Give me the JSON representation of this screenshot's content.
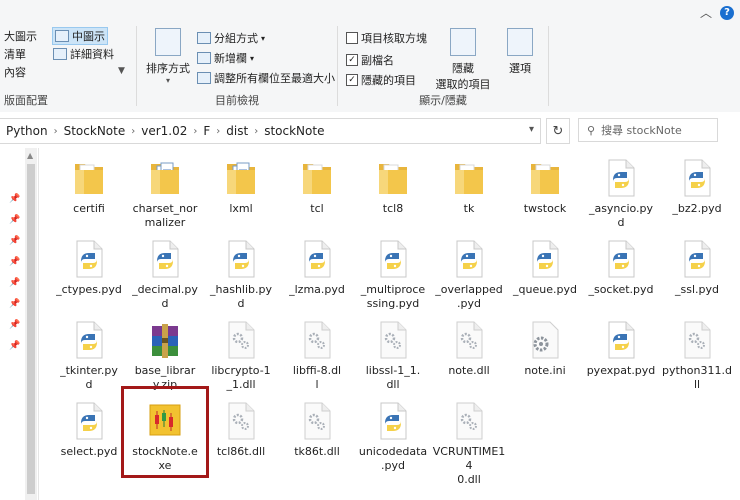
{
  "ribbon": {
    "layout": {
      "large_icons": "大圖示",
      "medium_icons": "中圖示",
      "list": "清單",
      "details": "詳細資料",
      "content": "內容",
      "group_label": "版面配置"
    },
    "current_view": {
      "sort_by": "排序方式",
      "group_by": "分組方式",
      "add_columns": "新增欄",
      "size_columns": "調整所有欄位至最適大小",
      "group_label": "目前檢視"
    },
    "show_hide": {
      "item_checkboxes": "項目核取方塊",
      "extensions": "副檔名",
      "hidden_items": "隱藏的項目",
      "hide_selected_1": "隱藏",
      "hide_selected_2": "選取的項目",
      "options": "選項",
      "group_label": "顯示/隱藏"
    }
  },
  "breadcrumb": [
    "Python",
    "StockNote",
    "ver1.02",
    "F",
    "dist",
    "stockNote"
  ],
  "search": {
    "placeholder": "搜尋 stockNote"
  },
  "files": [
    {
      "name": "certifi",
      "type": "folder"
    },
    {
      "name": "charset_normalizer",
      "type": "folder-doc"
    },
    {
      "name": "lxml",
      "type": "folder-doc"
    },
    {
      "name": "tcl",
      "type": "folder"
    },
    {
      "name": "tcl8",
      "type": "folder"
    },
    {
      "name": "tk",
      "type": "folder"
    },
    {
      "name": "twstock",
      "type": "folder"
    },
    {
      "name": "_asyncio.pyd",
      "type": "pyd"
    },
    {
      "name": "_bz2.pyd",
      "type": "pyd"
    },
    {
      "name": "_ctypes.pyd",
      "type": "pyd"
    },
    {
      "name": "_decimal.pyd",
      "type": "pyd"
    },
    {
      "name": "_hashlib.pyd",
      "type": "pyd"
    },
    {
      "name": "_lzma.pyd",
      "type": "pyd"
    },
    {
      "name": "_multiprocessing.pyd",
      "type": "pyd"
    },
    {
      "name": "_overlapped.pyd",
      "type": "pyd"
    },
    {
      "name": "_queue.pyd",
      "type": "pyd"
    },
    {
      "name": "_socket.pyd",
      "type": "pyd"
    },
    {
      "name": "_ssl.pyd",
      "type": "pyd"
    },
    {
      "name": "_tkinter.pyd",
      "type": "pyd"
    },
    {
      "name": "base_library.zip",
      "type": "zip"
    },
    {
      "name": "libcrypto-1_1.dll",
      "type": "dll"
    },
    {
      "name": "libffi-8.dll",
      "type": "dll"
    },
    {
      "name": "libssl-1_1.dll",
      "type": "dll"
    },
    {
      "name": "note.dll",
      "type": "dll"
    },
    {
      "name": "note.ini",
      "type": "ini"
    },
    {
      "name": "pyexpat.pyd",
      "type": "pyd"
    },
    {
      "name": "python311.dll",
      "type": "dll"
    },
    {
      "name": "select.pyd",
      "type": "pyd"
    },
    {
      "name": "stockNote.exe",
      "type": "exe"
    },
    {
      "name": "tcl86t.dll",
      "type": "dll"
    },
    {
      "name": "tk86t.dll",
      "type": "dll"
    },
    {
      "name": "unicodedata.pyd",
      "type": "pyd"
    },
    {
      "name": "VCRUNTIME140.dll",
      "type": "dll"
    }
  ],
  "colors": {
    "folder": "#f3c64b",
    "py_blue": "#3a74b5",
    "py_yellow": "#f5d14a",
    "highlight": "#a31818"
  }
}
